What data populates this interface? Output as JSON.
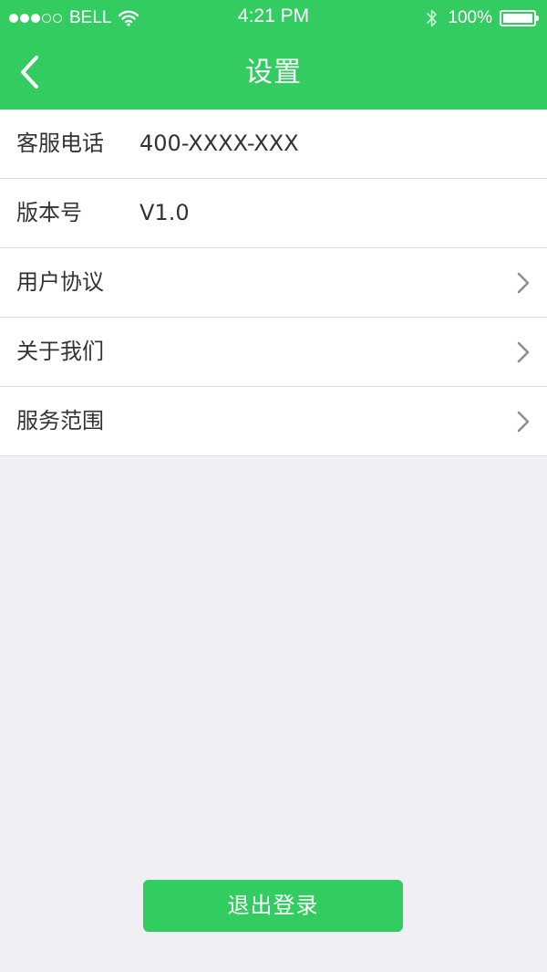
{
  "status_bar": {
    "carrier": "BELL",
    "time": "4:21 PM",
    "battery": "100%",
    "signal_strength_of_5": 3
  },
  "nav": {
    "title": "设置",
    "back_icon": "chevron-left-icon"
  },
  "settings": {
    "rows": [
      {
        "label": "客服电话",
        "value": "400-XXXX-XXX"
      },
      {
        "label": "版本号",
        "value": "V1.0"
      },
      {
        "label": "用户协议"
      },
      {
        "label": "关于我们"
      },
      {
        "label": "服务范围"
      }
    ]
  },
  "logout_label": "退出登录",
  "colors": {
    "accent": "#33cc60",
    "background": "#efeff4",
    "divider": "#dcdcdc",
    "chevron": "#8e8e93",
    "text": "#333333"
  }
}
